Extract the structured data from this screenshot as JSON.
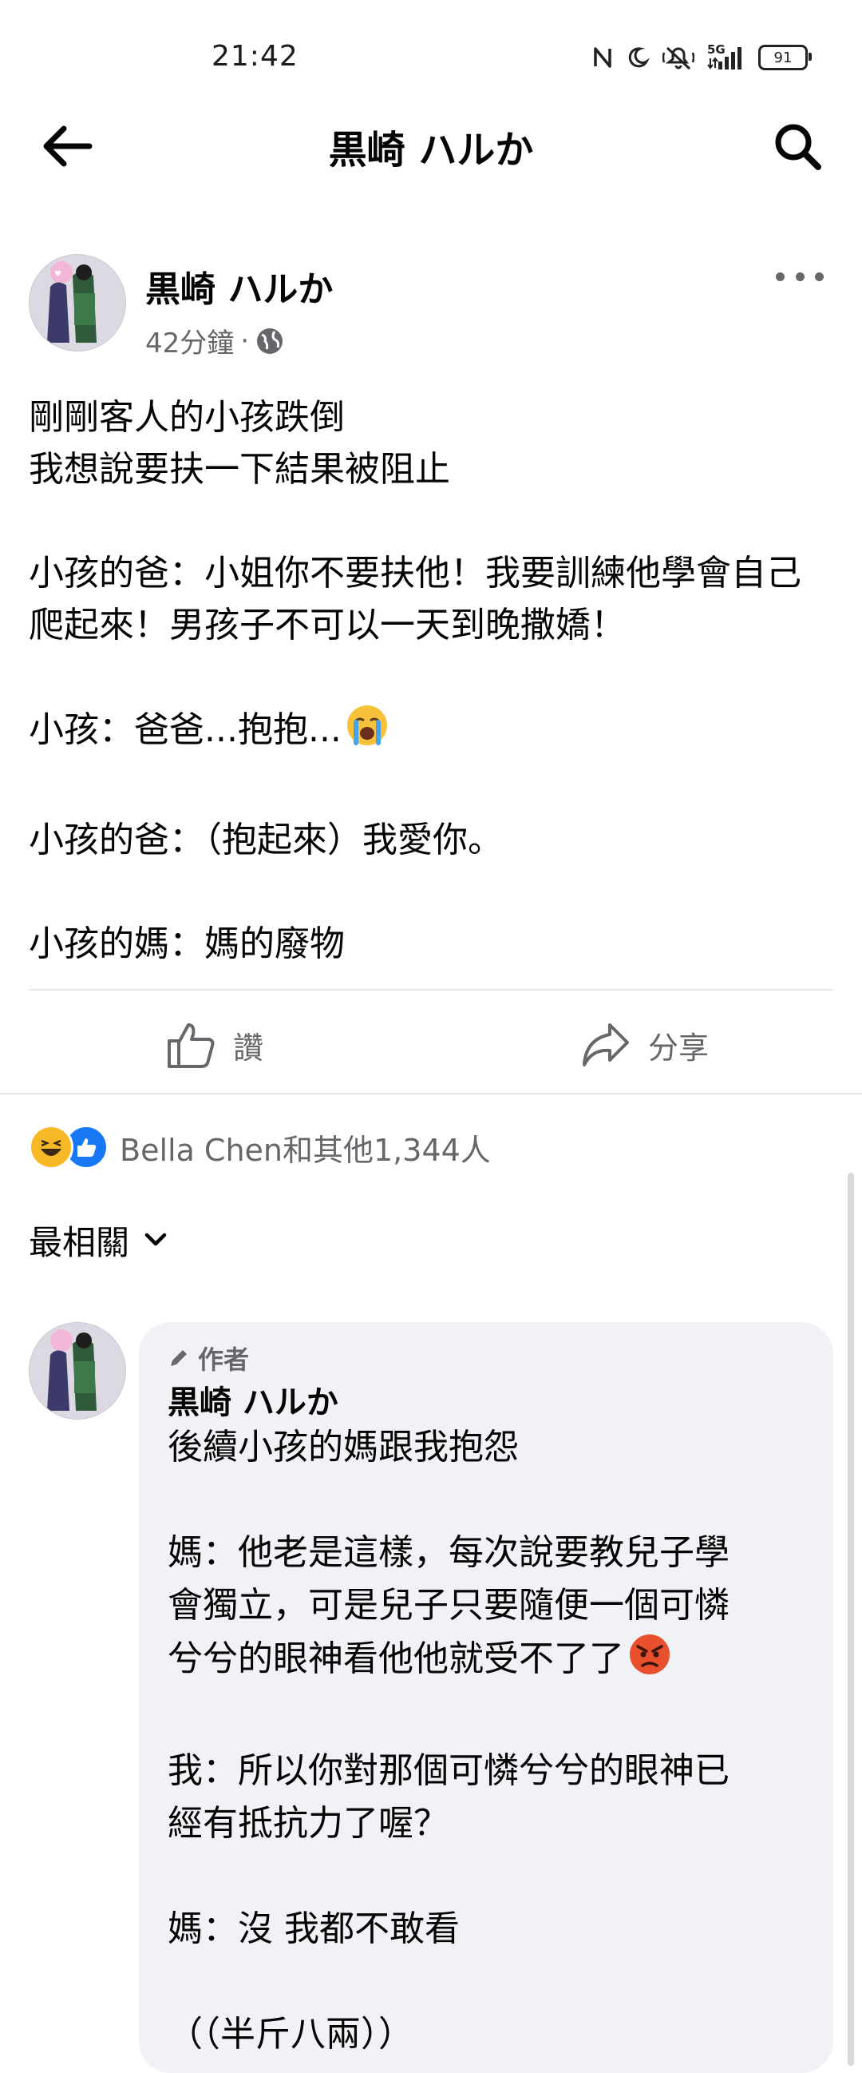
{
  "status_bar": {
    "time": "21:42",
    "network": "5G",
    "battery": "91",
    "icons": [
      "nfc-icon",
      "moon-icon",
      "mute-icon",
      "signal-icon",
      "battery-icon"
    ]
  },
  "nav": {
    "title": "黒崎 ハルか",
    "back_icon": "back-arrow-icon",
    "search_icon": "search-icon"
  },
  "post": {
    "author": "黒崎 ハルか",
    "time": "42分鐘",
    "separator": "·",
    "privacy_icon": "globe-icon",
    "paragraphs": [
      [
        "剛剛客人的小孩跌倒",
        "我想說要扶一下結果被阻止"
      ],
      [
        "小孩的爸：小姐你不要扶他！我要訓練他學會自己爬起來！男孩子不可以一天到晚撒嬌！"
      ],
      [
        "小孩：爸爸...抱抱..."
      ],
      [
        "小孩的爸：（抱起來）我愛你。"
      ],
      [
        "小孩的媽：媽的廢物"
      ]
    ],
    "crying_emoji": "loudly-crying-face"
  },
  "actions": {
    "like_label": "讚",
    "share_label": "分享"
  },
  "reactions": {
    "text": "Bella Chen和其他1,344人",
    "types": [
      "haha",
      "like"
    ]
  },
  "sort": {
    "label": "最相關"
  },
  "comment": {
    "badge": "作者",
    "author": "黒崎 ハルか",
    "lines": [
      [
        "後續小孩的媽跟我抱怨"
      ],
      [
        "媽：他老是這樣，每次說要教兒子學",
        "會獨立，可是兒子只要隨便一個可憐",
        "兮兮的眼神看他他就受不了了"
      ],
      [
        "我：所以你對那個可憐兮兮的眼神已",
        "經有抵抗力了喔？"
      ],
      [
        "媽：沒 我都不敢看"
      ],
      [
        "（（半斤八兩））"
      ]
    ],
    "angry_emoji": "angry-face"
  },
  "colors": {
    "text_primary": "#050505",
    "text_secondary": "#65676b",
    "bubble_bg": "#f0f2f5",
    "divider": "#e4e6eb",
    "like_blue": "#1877f2",
    "haha_yellow": "#f7b928"
  }
}
